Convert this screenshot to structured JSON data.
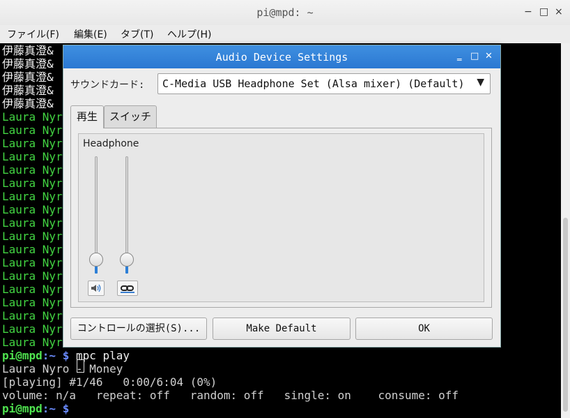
{
  "terminal": {
    "title": "pi@mpd: ~",
    "window_controls": {
      "minimize": "−",
      "maximize": "□",
      "close": "×"
    },
    "menu": [
      "ファイル(F)",
      "編集(E)",
      "タブ(T)",
      "ヘルプ(H)"
    ],
    "lines_obscured": [
      "伊藤真澄&",
      "伊藤真澄&",
      "伊藤真澄&",
      "伊藤真澄&",
      "伊藤真澄&",
      "Laura Nyr",
      "Laura Nyr",
      "Laura Nyr",
      "Laura Nyr",
      "Laura Nyr",
      "Laura Nyr",
      "Laura Nyr",
      "Laura Nyr",
      "Laura Nyr",
      "Laura Nyr",
      "Laura Nyr",
      "Laura Nyr",
      "Laura Nyr",
      "Laura Nyr",
      "Laura Nyr",
      "Laura Nyr",
      "Laura Nyr",
      "Laura Nyr"
    ],
    "prompt_user": "pi@mpd",
    "prompt_path": ":~ $",
    "command": " mpc play",
    "now_playing": "Laura Nyro - Money",
    "status": "[playing] #1/46   0:00/6:04 (0%)",
    "volume_line": "volume: n/a   repeat: off   random: off   single: on    consume: off"
  },
  "dialog": {
    "title": "Audio Device Settings",
    "controls": {
      "minimize": "‗",
      "maximize": "□",
      "close": "✕"
    },
    "sound_card_label": "サウンドカード:",
    "sound_card_value": "C-Media USB Headphone Set (Alsa mixer) (Default)",
    "tabs": [
      "再生",
      "スイッチ"
    ],
    "device_name": "Headphone",
    "sliders": [
      {
        "name": "left",
        "level": 0.04
      },
      {
        "name": "right",
        "level": 0.04
      }
    ],
    "buttons": {
      "select_controls": "コントロールの選択(S)...",
      "make_default": "Make Default",
      "ok": "OK"
    }
  }
}
